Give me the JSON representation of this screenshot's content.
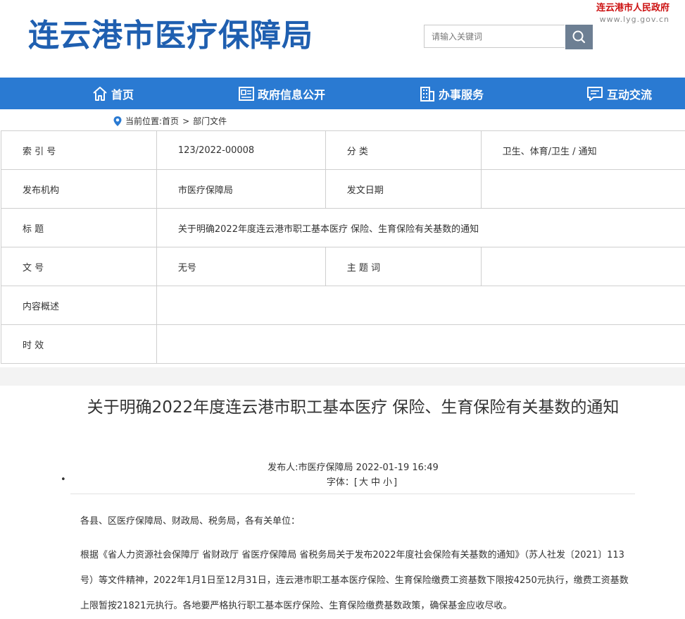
{
  "header": {
    "site_title": "连云港市医疗保障局",
    "gov_name": "连云港市人民政府",
    "gov_url": "www.lyg.gov.cn",
    "search_placeholder": "请输入关键词"
  },
  "nav": {
    "items": [
      {
        "label": "首页",
        "icon": "home-icon"
      },
      {
        "label": "政府信息公开",
        "icon": "document-icon"
      },
      {
        "label": "办事服务",
        "icon": "building-icon"
      },
      {
        "label": "互动交流",
        "icon": "chat-icon"
      }
    ]
  },
  "breadcrumb": {
    "prefix": "当前位置:",
    "home": "首页",
    "sep": ">",
    "current": "部门文件"
  },
  "info": {
    "index_label": "索 引 号",
    "index_value": "123/2022-00008",
    "category_label": "分 类",
    "category_value": "卫生、体育/卫生 / 通知",
    "org_label": "发布机构",
    "org_value": "市医疗保障局",
    "date_label": "发文日期",
    "date_value": "",
    "title_label": "标 题",
    "title_value": "关于明确2022年度连云港市职工基本医疗 保险、生育保险有关基数的通知",
    "docno_label": "文 号",
    "docno_value": "无号",
    "keyword_label": "主 题 词",
    "keyword_value": "",
    "summary_label": "内容概述",
    "summary_value": "",
    "validity_label": "时 效",
    "validity_value": ""
  },
  "article": {
    "title": "关于明确2022年度连云港市职工基本医疗 保险、生育保险有关基数的通知",
    "meta": "发布人:市医疗保障局 2022-01-19 16:49",
    "font_label": "字体：[",
    "font_large": "大",
    "font_medium": "中",
    "font_small": "小",
    "font_close": "]",
    "bullet": "•",
    "salutation": "各县、区医疗保障局、财政局、税务局，各有关单位：",
    "body": "根据《省人力资源社会保障厅 省财政厅 省医疗保障局 省税务局关于发布2022年度社会保险有关基数的通知》（苏人社发〔2021〕113号）等文件精神，2022年1月1日至12月31日，连云港市职工基本医疗保险、生育保险缴费工资基数下限按4250元执行，缴费工资基数上限暂按21821元执行。各地要严格执行职工基本医疗保险、生育保险缴费基数政策，确保基金应收尽收。"
  },
  "colors": {
    "brand_blue": "#1f5fb0",
    "nav_blue": "#2a7ad2",
    "gov_red": "#cc1010"
  }
}
